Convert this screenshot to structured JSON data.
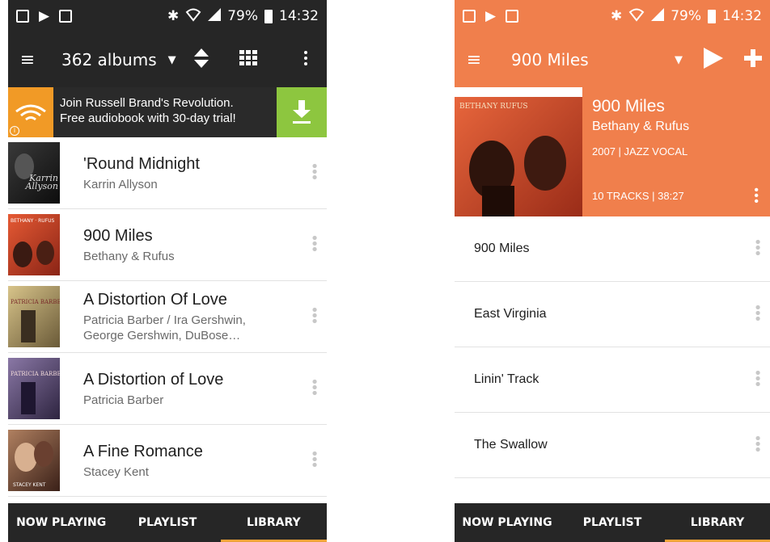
{
  "status_bar": {
    "battery": "79%",
    "time": "14:32"
  },
  "library": {
    "toolbar": {
      "title": "362 albums"
    },
    "ad": {
      "line1": "Join Russell Brand's Revolution.",
      "line2": "Free audiobook with 30-day trial!"
    },
    "albums": [
      {
        "title": "'Round Midnight",
        "artist": "Karrin Allyson",
        "art_text": "Karrin Allyson",
        "art_color": "#1a1a1a"
      },
      {
        "title": "900 Miles",
        "artist": "Bethany & Rufus",
        "art_text": "BETHANY RUFUS",
        "art_color": "#c9412a"
      },
      {
        "title": "A Distortion Of Love",
        "artist_line1": "Patricia Barber / Ira Gershwin,",
        "artist_line2": "George Gershwin, DuBose…",
        "art_text": "PATRICIA BARBER",
        "art_color": "#b9a36a"
      },
      {
        "title": "A Distortion of Love",
        "artist": "Patricia Barber",
        "art_text": "PATRICIA BARBER",
        "art_color": "#6e5a84"
      },
      {
        "title": "A Fine Romance",
        "artist": "Stacey Kent",
        "art_text": "STACEY KENT",
        "art_color": "#7a4a3a"
      }
    ]
  },
  "album_detail": {
    "toolbar": {
      "title": "900 Miles"
    },
    "header": {
      "art_text": "BETHANY RUFUS",
      "title": "900 Miles",
      "artist": "Bethany & Rufus",
      "meta": "2007 | JAZZ VOCAL",
      "tracks": "10 TRACKS | 38:27"
    },
    "tracks": [
      "900 Miles",
      "East Virginia",
      "Linin' Track",
      "The Swallow"
    ]
  },
  "bottom_nav": {
    "now_playing": "NOW PLAYING",
    "playlist": "PLAYLIST",
    "library": "LIBRARY"
  },
  "colors": {
    "dark": "#262626",
    "accent": "#f07f4c",
    "tab_indicator": "#f0a43a",
    "ad_orange": "#f19a26",
    "ad_green": "#8dc63f"
  },
  "icons": [
    "menu-icon",
    "sort-icon",
    "grid-view-icon",
    "overflow-menu-icon",
    "audible-icon",
    "download-icon",
    "play-icon",
    "add-icon",
    "bluetooth-icon",
    "wifi-icon",
    "signal-icon",
    "battery-icon"
  ]
}
